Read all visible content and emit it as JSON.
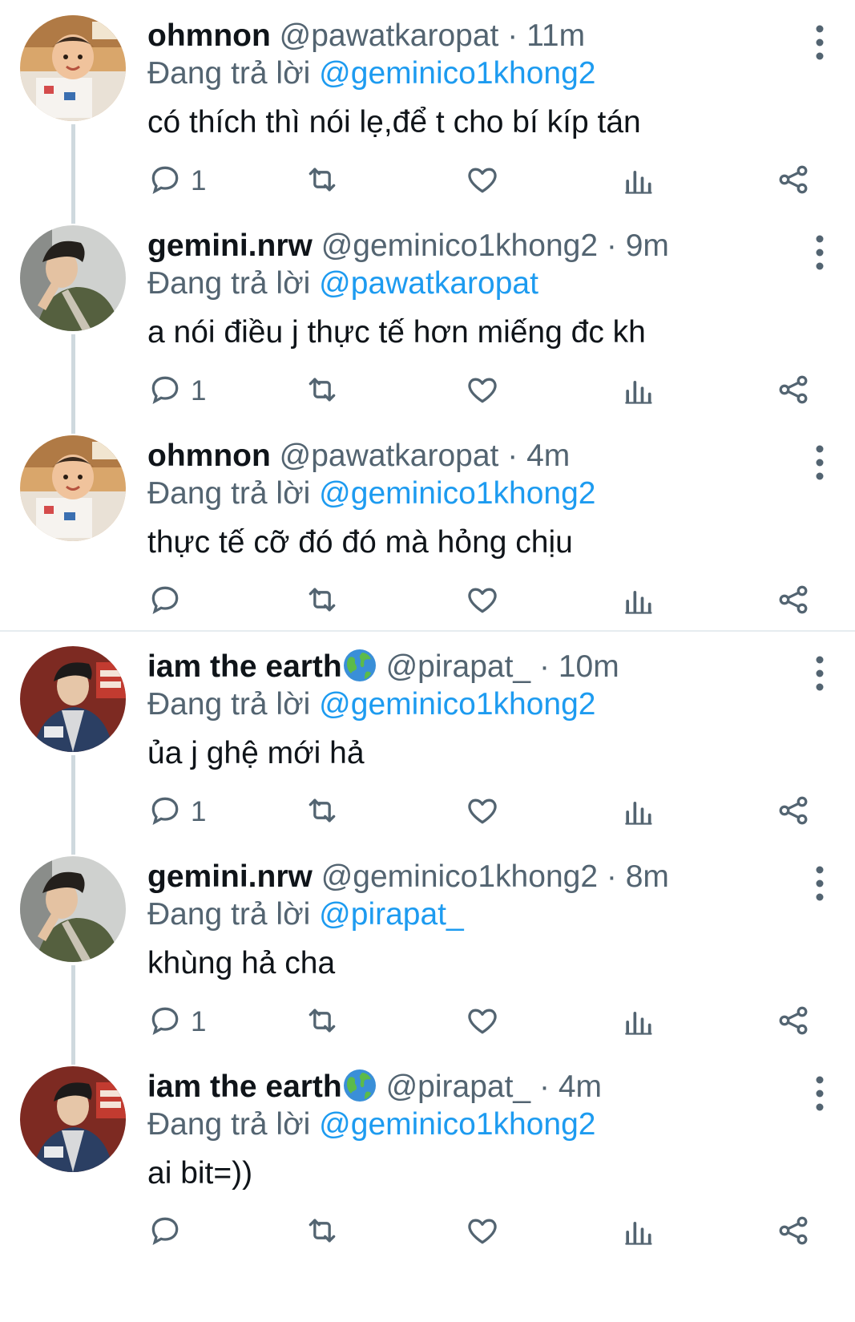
{
  "tweets": [
    {
      "name": "ohmnon",
      "handle": "@pawatkaropat",
      "time": "11m",
      "reply_prefix": "Đang trả lời",
      "reply_to": "@geminico1khong2",
      "text": "có thích thì nói lẹ,để t cho bí kíp tán",
      "reply_count": "1",
      "emoji": ""
    },
    {
      "name": "gemini.nrw",
      "handle": "@geminico1khong2",
      "time": "9m",
      "reply_prefix": "Đang trả lời",
      "reply_to": "@pawatkaropat",
      "text": "a nói điều j thực tế hơn miếng đc kh",
      "reply_count": "1",
      "emoji": ""
    },
    {
      "name": "ohmnon",
      "handle": "@pawatkaropat",
      "time": "4m",
      "reply_prefix": "Đang trả lời",
      "reply_to": "@geminico1khong2",
      "text": "thực tế cỡ đó đó mà hỏng chịu",
      "reply_count": "",
      "emoji": ""
    },
    {
      "name": "iam the earth",
      "handle": "@pirapat_",
      "time": "10m",
      "reply_prefix": "Đang trả lời",
      "reply_to": "@geminico1khong2",
      "text": "ủa j ghệ mới hả",
      "reply_count": "1",
      "emoji": "globe"
    },
    {
      "name": "gemini.nrw",
      "handle": "@geminico1khong2",
      "time": "8m",
      "reply_prefix": "Đang trả lời",
      "reply_to": "@pirapat_",
      "text": "khùng hả cha",
      "reply_count": "1",
      "emoji": ""
    },
    {
      "name": "iam the earth",
      "handle": "@pirapat_",
      "time": "4m",
      "reply_prefix": "Đang trả lời",
      "reply_to": "@geminico1khong2",
      "text": "ai bit=))",
      "reply_count": "",
      "emoji": "globe"
    }
  ],
  "separator": "·",
  "icons": [
    "reply-icon",
    "retweet-icon",
    "like-icon",
    "views-icon",
    "share-icon",
    "more-icon",
    "globe-emoji-icon"
  ],
  "colors": {
    "mention": "#1d9bf0",
    "muted": "#536471",
    "text": "#0f1419",
    "thread_line": "#cfd9de",
    "divider": "#e6ecf0"
  }
}
